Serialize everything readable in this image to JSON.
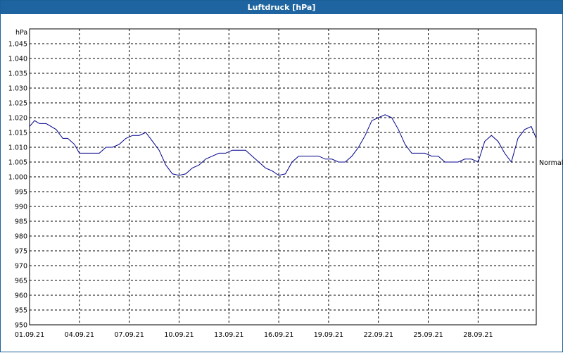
{
  "window": {
    "title": "Luftdruck [hPa]"
  },
  "chart_data": {
    "type": "line",
    "title": "Luftdruck [hPa]",
    "ylabel": "hPa",
    "xlabel": "",
    "ylim": [
      950,
      1050
    ],
    "yticks": [
      950,
      955,
      960,
      965,
      970,
      975,
      980,
      985,
      990,
      995,
      1000,
      1005,
      1010,
      1015,
      1020,
      1025,
      1030,
      1035,
      1040,
      1045
    ],
    "ytick_labels": [
      "950",
      "955",
      "960",
      "965",
      "970",
      "975",
      "980",
      "985",
      "990",
      "995",
      "1.000",
      "1.005",
      "1.010",
      "1.015",
      "1.020",
      "1.025",
      "1.030",
      "1.035",
      "1.040",
      "1.045"
    ],
    "x_range_days": [
      1,
      31
    ],
    "xticks": [
      1,
      4,
      7,
      10,
      13,
      16,
      19,
      22,
      25,
      28
    ],
    "xtick_labels": [
      "01.09.21",
      "04.09.21",
      "07.09.21",
      "10.09.21",
      "13.09.21",
      "16.09.21",
      "19.09.21",
      "22.09.21",
      "25.09.21",
      "28.09.21"
    ],
    "grid": true,
    "reference_line": {
      "label": "Normal",
      "value": 1005
    },
    "series": [
      {
        "color": "#00008b",
        "x": [
          1.0,
          1.3,
          1.6,
          2.0,
          2.3,
          2.6,
          3.0,
          3.3,
          3.7,
          4.0,
          4.4,
          4.8,
          5.2,
          5.6,
          6.0,
          6.4,
          6.8,
          7.2,
          7.6,
          8.0,
          8.4,
          8.8,
          9.2,
          9.6,
          10.0,
          10.4,
          10.8,
          11.2,
          11.6,
          12.0,
          12.4,
          12.8,
          13.2,
          13.6,
          14.0,
          14.4,
          14.8,
          15.2,
          15.6,
          16.0,
          16.4,
          16.8,
          17.2,
          17.6,
          18.0,
          18.4,
          18.8,
          19.2,
          19.6,
          20.0,
          20.4,
          20.8,
          21.2,
          21.6,
          22.0,
          22.4,
          22.8,
          23.2,
          23.6,
          24.0,
          24.4,
          24.8,
          25.2,
          25.6,
          26.0,
          26.4,
          26.8,
          27.2,
          27.6,
          28.0,
          28.4,
          28.8,
          29.2,
          29.6,
          30.0,
          30.4,
          30.8,
          31.2,
          31.5
        ],
        "y": [
          1017,
          1019,
          1018,
          1018,
          1017,
          1016,
          1013,
          1013,
          1011,
          1008,
          1008,
          1008,
          1008,
          1010,
          1010,
          1011,
          1013,
          1014,
          1014,
          1015,
          1012,
          1009,
          1004,
          1001,
          1000.5,
          1001,
          1003,
          1004,
          1006,
          1007,
          1008,
          1008,
          1009,
          1009,
          1009,
          1007,
          1005,
          1003,
          1002,
          1000.5,
          1001,
          1005,
          1007,
          1007,
          1007,
          1007,
          1006,
          1006,
          1005,
          1005,
          1007,
          1010,
          1014,
          1019,
          1020,
          1021,
          1020,
          1016,
          1011,
          1008,
          1008,
          1008,
          1007,
          1007,
          1005,
          1005,
          1005,
          1006,
          1006,
          1005,
          1012,
          1014,
          1012,
          1008,
          1005,
          1013,
          1016,
          1017,
          1013
        ]
      }
    ]
  }
}
